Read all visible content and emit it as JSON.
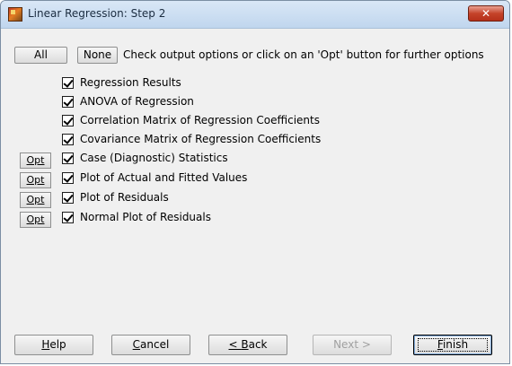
{
  "window": {
    "title": "Linear Regression: Step 2",
    "close_label": "✕"
  },
  "toolbar": {
    "all_label": "All",
    "none_label": "None",
    "hint": "Check output options or click on an 'Opt' button for further options"
  },
  "opt_label": "Opt",
  "options": [
    {
      "label": "Regression Results",
      "checked": true,
      "has_opt": false
    },
    {
      "label": "ANOVA of Regression",
      "checked": true,
      "has_opt": false
    },
    {
      "label": "Correlation Matrix of Regression Coefficients",
      "checked": true,
      "has_opt": false
    },
    {
      "label": "Covariance Matrix of Regression Coefficients",
      "checked": true,
      "has_opt": false
    },
    {
      "label": "Case (Diagnostic) Statistics",
      "checked": true,
      "has_opt": true
    },
    {
      "label": "Plot of Actual and Fitted Values",
      "checked": true,
      "has_opt": true
    },
    {
      "label": "Plot of Residuals",
      "checked": true,
      "has_opt": true
    },
    {
      "label": "Normal Plot of Residuals",
      "checked": true,
      "has_opt": true
    }
  ],
  "buttons": {
    "help": {
      "mnemonic": "H",
      "rest": "elp"
    },
    "cancel": {
      "mnemonic": "C",
      "rest": "ancel"
    },
    "back": {
      "prefix": "< ",
      "mnemonic": "B",
      "rest": "ack"
    },
    "next": {
      "text": "Next >",
      "disabled": true
    },
    "finish": {
      "mnemonic": "F",
      "rest": "inish"
    }
  }
}
